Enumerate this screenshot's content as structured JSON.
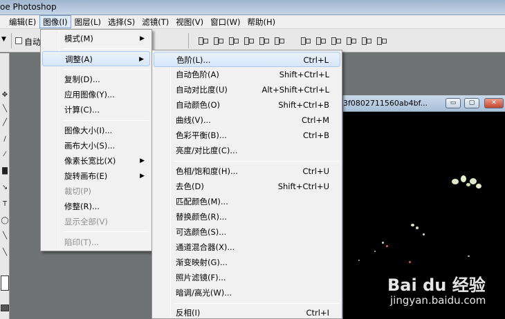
{
  "window": {
    "title": "oe Photoshop"
  },
  "menubar": {
    "items": [
      {
        "label": "编辑(E)",
        "active": false
      },
      {
        "label": "图像(I)",
        "active": true
      },
      {
        "label": "图层(L)",
        "active": false
      },
      {
        "label": "选择(S)",
        "active": false
      },
      {
        "label": "滤镜(T)",
        "active": false
      },
      {
        "label": "视图(V)",
        "active": false
      },
      {
        "label": "窗口(W)",
        "active": false
      },
      {
        "label": "帮助(H)",
        "active": false
      }
    ]
  },
  "options_bar": {
    "auto_select_label": "自动"
  },
  "document": {
    "title": "3f0802711560ab4bf...",
    "buttons": {
      "minimize": "▭",
      "restore": "▢",
      "close": "✕"
    }
  },
  "image_menu": {
    "items": [
      {
        "label": "模式(M)",
        "submenu": true
      },
      {
        "label": "调整(A)",
        "submenu": true,
        "highlighted": true
      },
      {
        "label": "复制(D)..."
      },
      {
        "label": "应用图像(Y)..."
      },
      {
        "label": "计算(C)..."
      },
      {
        "label": "图像大小(I)..."
      },
      {
        "label": "画布大小(S)..."
      },
      {
        "label": "像素长宽比(X)",
        "submenu": true
      },
      {
        "label": "旋转画布(E)",
        "submenu": true
      },
      {
        "label": "裁切(P)",
        "disabled": true
      },
      {
        "label": "修整(R)..."
      },
      {
        "label": "显示全部(V)",
        "disabled": true
      },
      {
        "label": "陷印(T)...",
        "disabled": true
      }
    ]
  },
  "adjust_menu": {
    "items": [
      {
        "label": "色阶(L)...",
        "shortcut": "Ctrl+L",
        "highlighted": true
      },
      {
        "label": "自动色阶(A)",
        "shortcut": "Shift+Ctrl+L"
      },
      {
        "label": "自动对比度(U)",
        "shortcut": "Alt+Shift+Ctrl+L"
      },
      {
        "label": "自动颜色(O)",
        "shortcut": "Shift+Ctrl+B"
      },
      {
        "label": "曲线(V)...",
        "shortcut": "Ctrl+M"
      },
      {
        "label": "色彩平衡(B)...",
        "shortcut": "Ctrl+B"
      },
      {
        "label": "亮度/对比度(C)...",
        "shortcut": ""
      },
      {
        "label": "色相/饱和度(H)...",
        "shortcut": "Ctrl+U"
      },
      {
        "label": "去色(D)",
        "shortcut": "Shift+Ctrl+U"
      },
      {
        "label": "匹配颜色(M)...",
        "shortcut": ""
      },
      {
        "label": "替换颜色(R)...",
        "shortcut": ""
      },
      {
        "label": "可选颜色(S)...",
        "shortcut": ""
      },
      {
        "label": "通道混合器(X)...",
        "shortcut": ""
      },
      {
        "label": "渐变映射(G)...",
        "shortcut": ""
      },
      {
        "label": "照片滤镜(F)...",
        "shortcut": ""
      },
      {
        "label": "暗调/高光(W)...",
        "shortcut": ""
      },
      {
        "label": "反相(I)",
        "shortcut": "Ctrl+I"
      }
    ]
  },
  "watermark": {
    "brand": "Bai du 经验",
    "url": "jingyan.baidu.com"
  },
  "colors": {
    "highlight": "#d7e6f8",
    "menu_bg": "#f1f1f1",
    "disabled": "#8d8d8d"
  }
}
